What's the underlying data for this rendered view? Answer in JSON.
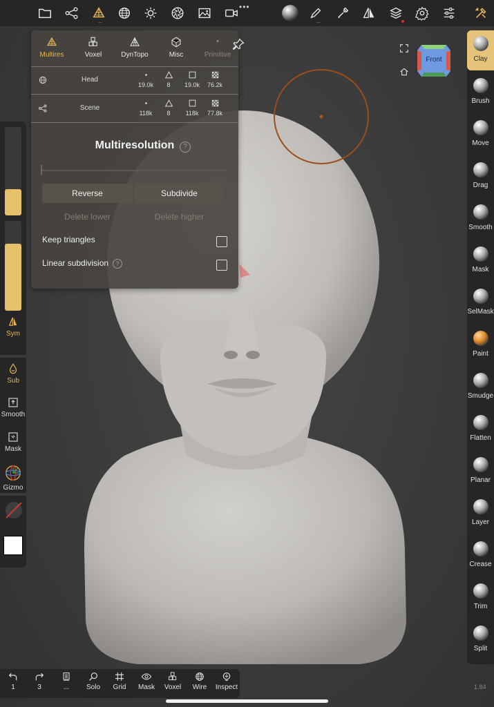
{
  "topbar": {
    "icons": [
      "folder-icon",
      "scene-graph-icon",
      "multires-icon",
      "wireframe-sphere-icon",
      "sun-icon",
      "aperture-icon",
      "image-icon",
      "camera-icon",
      "matcap-sphere-icon",
      "pen-icon",
      "eyedropper-icon",
      "symmetry-icon",
      "layers-icon",
      "gear-icon",
      "sliders-icon",
      "tools-icon"
    ],
    "colors": {
      "accent": "#e5b454",
      "notification": "#e0302a"
    }
  },
  "panel": {
    "tabs": [
      {
        "label": "Multires",
        "icon": "multires-icon",
        "state": "active"
      },
      {
        "label": "Voxel",
        "icon": "voxel-icon",
        "state": "normal"
      },
      {
        "label": "DynTopo",
        "icon": "dyntopo-icon",
        "state": "normal"
      },
      {
        "label": "Misc",
        "icon": "misc-icon",
        "state": "normal"
      },
      {
        "label": "Primitive",
        "icon": "primitive-icon",
        "state": "disabled"
      }
    ],
    "rows": [
      {
        "name": "Head",
        "vertices": "19.0k",
        "triangles": "8",
        "quads": "19.0k",
        "faces": "76.2k"
      },
      {
        "name": "Scene",
        "vertices": "118k",
        "triangles": "8",
        "quads": "118k",
        "faces": "77.8k"
      }
    ],
    "title": "Multiresolution",
    "help": "?",
    "buttons": {
      "reverse": "Reverse",
      "subdivide": "Subdivide",
      "delete_lower": "Delete lower",
      "delete_higher": "Delete higher"
    },
    "options": [
      {
        "label": "Keep triangles",
        "checked": false,
        "help": false
      },
      {
        "label": "Linear subdivision",
        "checked": false,
        "help": true
      }
    ]
  },
  "leftbar": {
    "radius_level": 0.3,
    "intensity_level": 0.75,
    "items": [
      {
        "label": "Sym",
        "icon": "symmetry-icon",
        "active": true
      },
      {
        "label": "Sub",
        "icon": "drop-icon",
        "active": true
      },
      {
        "label": "Smooth",
        "icon": "smooth-icon",
        "active": false
      },
      {
        "label": "Mask",
        "icon": "mask-icon",
        "active": false
      },
      {
        "label": "Gizmo",
        "icon": "gizmo-icon",
        "active": false
      }
    ]
  },
  "viewcube": {
    "label": "Front"
  },
  "rightbar": {
    "tools": [
      {
        "label": "Clay",
        "active": true
      },
      {
        "label": "Brush",
        "active": false
      },
      {
        "label": "Move",
        "active": false
      },
      {
        "label": "Drag",
        "active": false
      },
      {
        "label": "Smooth",
        "active": false
      },
      {
        "label": "Mask",
        "active": false
      },
      {
        "label": "SelMask",
        "active": false
      },
      {
        "label": "Paint",
        "active": false
      },
      {
        "label": "Smudge",
        "active": false
      },
      {
        "label": "Flatten",
        "active": false
      },
      {
        "label": "Planar",
        "active": false
      },
      {
        "label": "Layer",
        "active": false
      },
      {
        "label": "Crease",
        "active": false
      },
      {
        "label": "Trim",
        "active": false
      },
      {
        "label": "Split",
        "active": false
      }
    ]
  },
  "bottombar": {
    "items": [
      {
        "label": "1",
        "icon": "undo-icon"
      },
      {
        "label": "3",
        "icon": "redo-icon"
      },
      {
        "label": "...",
        "icon": "stack-icon"
      },
      {
        "label": "Solo",
        "icon": "magnifier-icon"
      },
      {
        "label": "Grid",
        "icon": "grid-icon"
      },
      {
        "label": "Mask",
        "icon": "eye-icon"
      },
      {
        "label": "Voxel",
        "icon": "voxel-icon"
      },
      {
        "label": "Wire",
        "icon": "wireframe-sphere-icon"
      },
      {
        "label": "Inspect",
        "icon": "inspect-icon"
      }
    ]
  },
  "version": "1.84"
}
